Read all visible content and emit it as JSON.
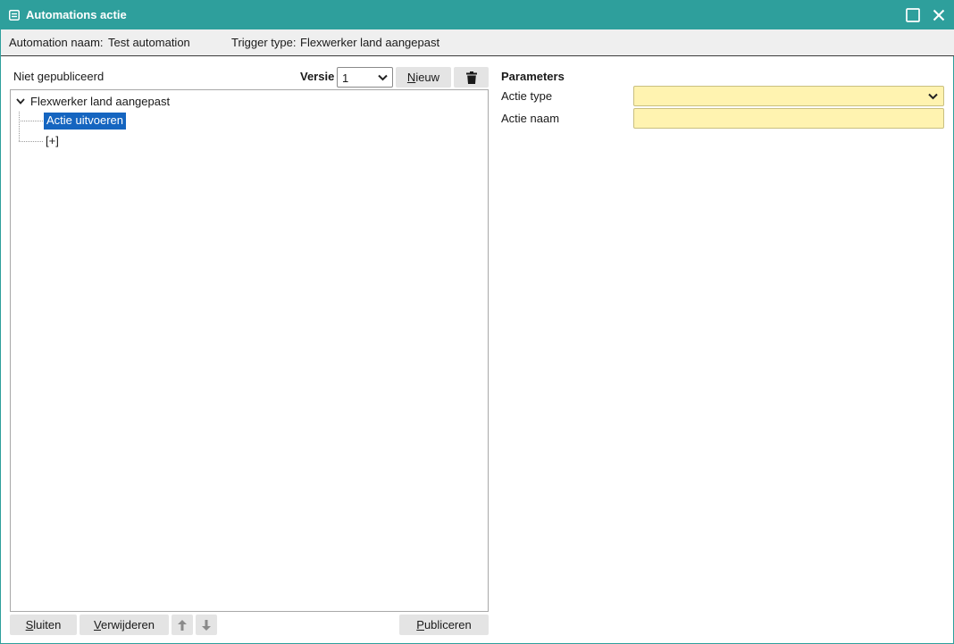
{
  "window": {
    "title": "Automations actie",
    "title_icon": "form-icon",
    "maximize_icon": "maximize-icon",
    "close_icon": "close-icon",
    "accent_color": "#2e9f9c"
  },
  "info": {
    "automation_label": "Automation naam:",
    "automation_value": "Test automation",
    "trigger_label": "Trigger type:",
    "trigger_value": "Flexwerker land aangepast"
  },
  "left": {
    "status": "Niet gepubliceerd",
    "versie_label": "Versie",
    "versie_value": "1",
    "new_button": "Nieuw",
    "delete_icon": "trash-icon"
  },
  "tree": {
    "root": "Flexwerker land aangepast",
    "selected_node": "Actie uitvoeren",
    "add_node": "[+]",
    "selection_color": "#1565c0"
  },
  "parameters": {
    "title": "Parameters",
    "actie_type_label": "Actie type",
    "actie_type_value": "",
    "actie_naam_label": "Actie naam",
    "actie_naam_value": "",
    "required_color": "#fff3b0"
  },
  "footer": {
    "close_button": "Sluiten",
    "delete_button": "Verwijderen",
    "up_icon": "arrow-up-icon",
    "down_icon": "arrow-down-icon",
    "publish_button": "Publiceren"
  }
}
